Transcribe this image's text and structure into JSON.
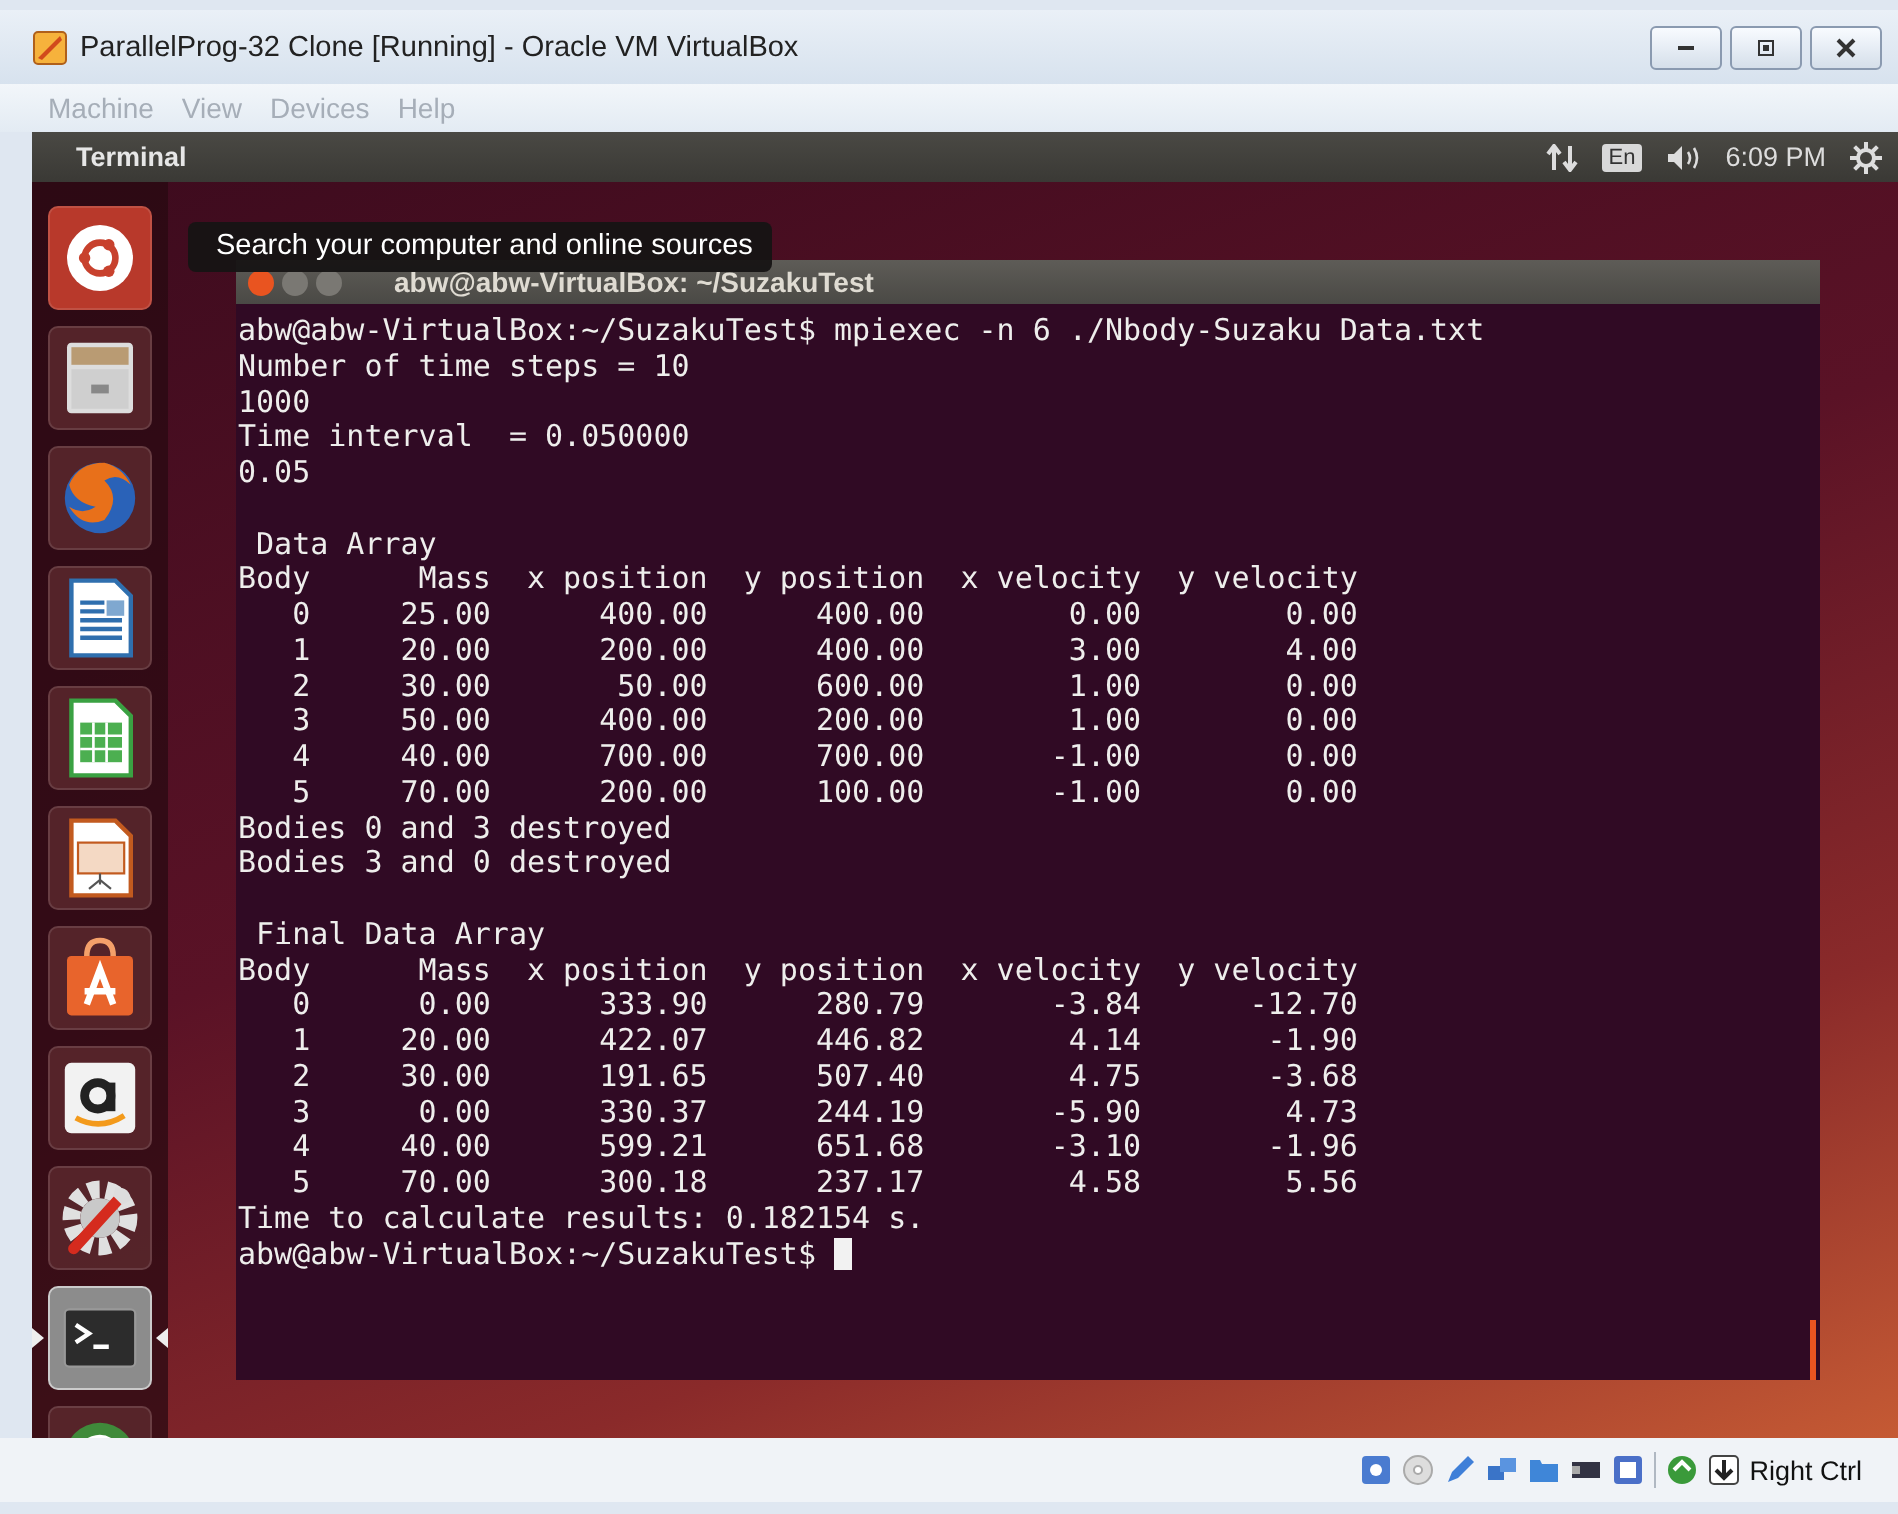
{
  "window": {
    "title": "ParallelProg-32 Clone [Running] - Oracle VM VirtualBox"
  },
  "menu": [
    {
      "label": "Machine",
      "disabled": true
    },
    {
      "label": "View",
      "disabled": true
    },
    {
      "label": "Devices",
      "disabled": true
    },
    {
      "label": "Help",
      "disabled": true
    }
  ],
  "panel": {
    "app_name": "Terminal",
    "keyboard": "En",
    "clock": "6:09 PM"
  },
  "launcher": {
    "tooltip": "Search your computer and online sources",
    "items": [
      {
        "kind": "dash",
        "running": false
      },
      {
        "kind": "files",
        "running": false
      },
      {
        "kind": "browser",
        "running": false
      },
      {
        "kind": "writer",
        "running": false
      },
      {
        "kind": "calc",
        "running": false
      },
      {
        "kind": "impress",
        "running": false
      },
      {
        "kind": "software",
        "running": false
      },
      {
        "kind": "amazon",
        "running": false
      },
      {
        "kind": "settings",
        "running": false
      },
      {
        "kind": "terminal",
        "running": true
      },
      {
        "kind": "updater",
        "running": false
      }
    ]
  },
  "terminal": {
    "title": "abw@abw-VirtualBox: ~/SuzakuTest",
    "cursor": true,
    "blocks": [
      [
        "abw@abw-VirtualBox:~/SuzakuTest$ mpiexec -n 6 ./Nbody-Suzaku Data.txt",
        "Number of time steps = 10",
        "1000",
        "Time interval  = 0.050000",
        "0.05"
      ],
      [
        " Data Array",
        "Body      Mass  x position  y position  x velocity  y velocity",
        "   0     25.00      400.00      400.00        0.00        0.00",
        "   1     20.00      200.00      400.00        3.00        4.00",
        "   2     30.00       50.00      600.00        1.00        0.00",
        "   3     50.00      400.00      200.00        1.00        0.00",
        "   4     40.00      700.00      700.00       -1.00        0.00",
        "   5     70.00      200.00      100.00       -1.00        0.00",
        "Bodies 0 and 3 destroyed",
        "Bodies 3 and 0 destroyed"
      ],
      [
        " Final Data Array",
        "Body      Mass  x position  y position  x velocity  y velocity",
        "   0      0.00      333.90      280.79       -3.84      -12.70",
        "   1     20.00      422.07      446.82        4.14       -1.90",
        "   2     30.00      191.65      507.40        4.75       -3.68",
        "   3      0.00      330.37      244.19       -5.90        4.73",
        "   4     40.00      599.21      651.68       -3.10       -1.96",
        "   5     70.00      300.18      237.17        4.58        5.56",
        "Time to calculate results: 0.182154 s.",
        "abw@abw-VirtualBox:~/SuzakuTest$"
      ]
    ]
  },
  "status_bar": {
    "host_key": "Right Ctrl"
  }
}
